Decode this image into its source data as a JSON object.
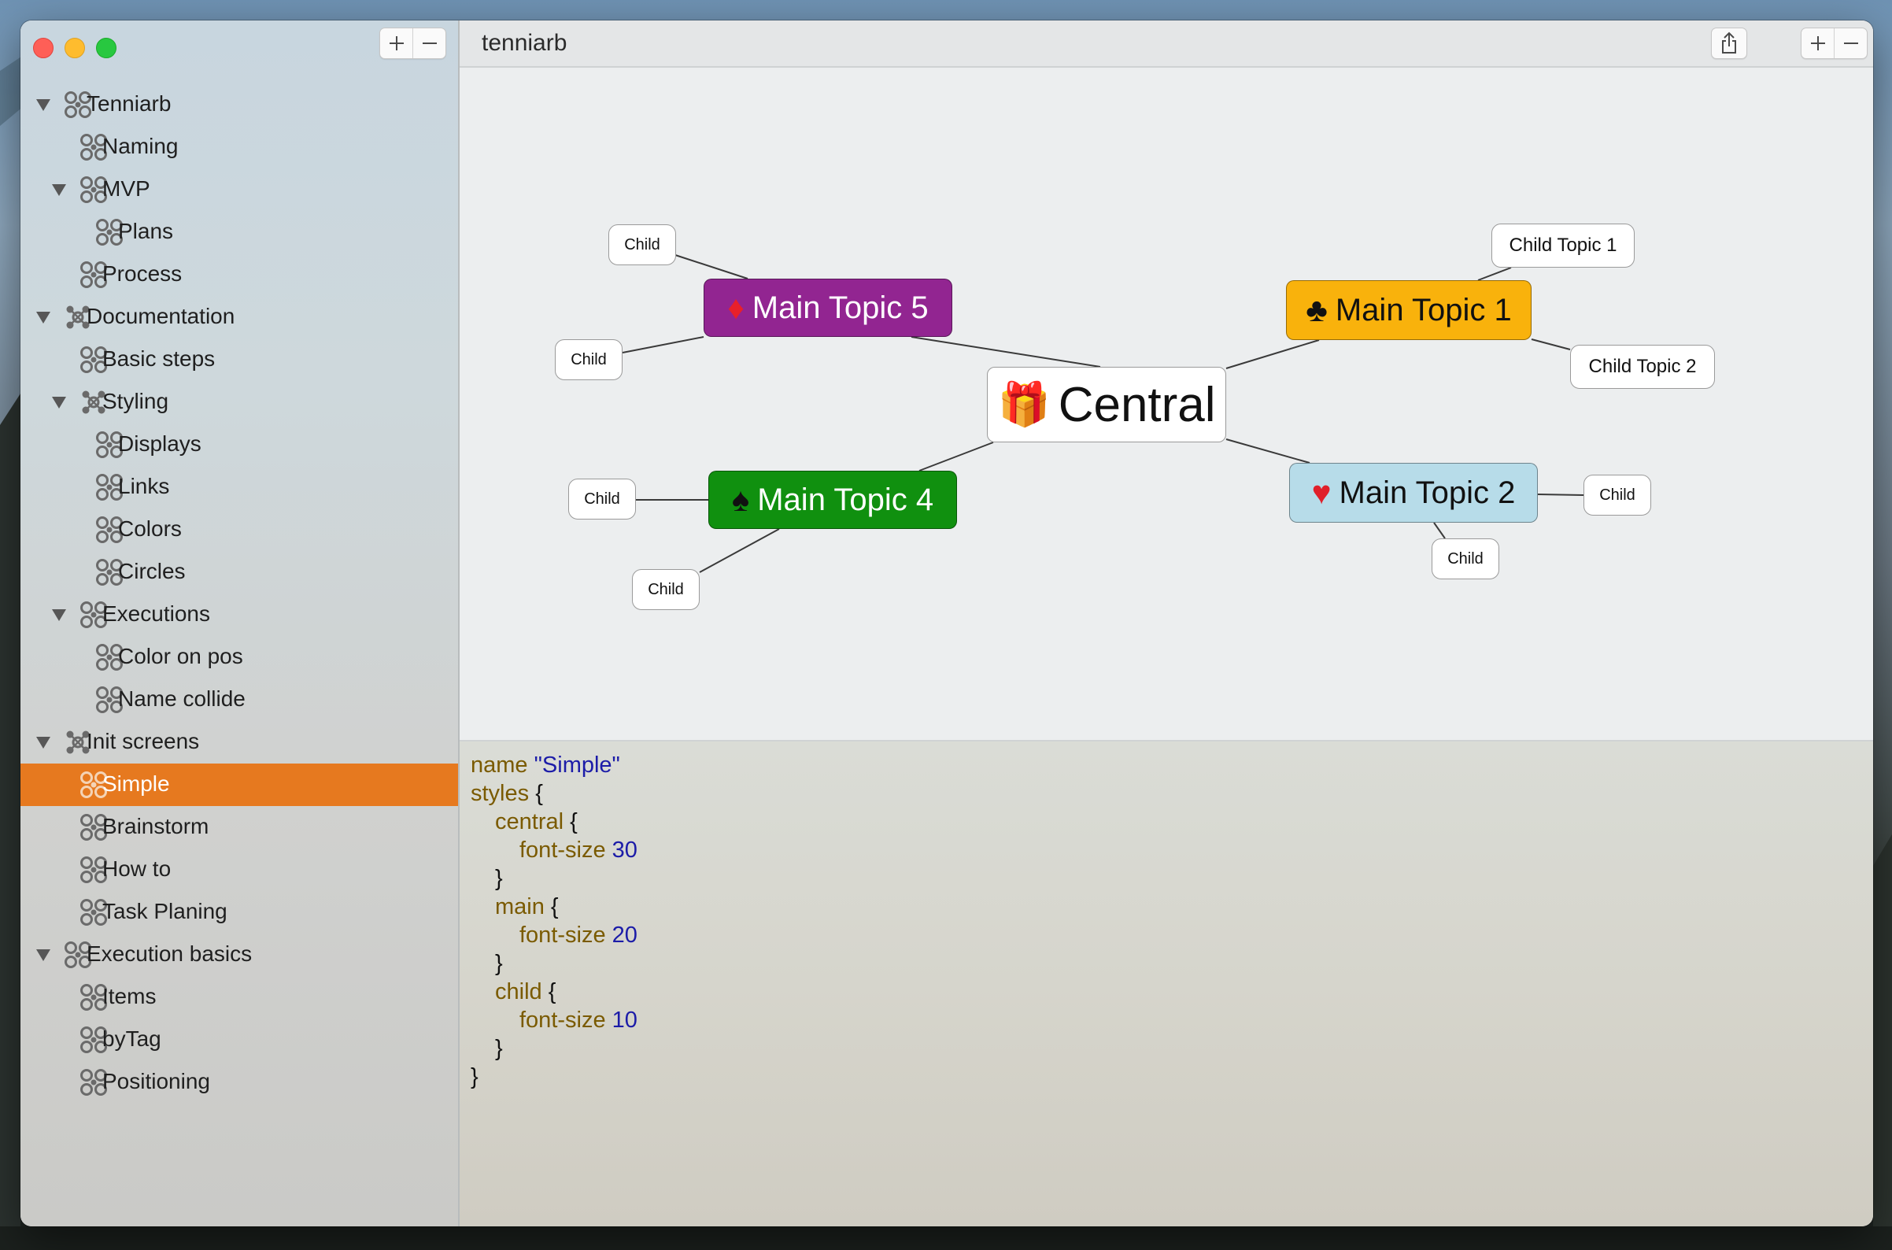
{
  "window": {
    "title": "tenniarb"
  },
  "sidebar": {
    "add_label": "+",
    "remove_label": "−",
    "items": [
      {
        "label": "Tenniarb",
        "level": 0,
        "expanded": true,
        "icon": "mindmap-icon"
      },
      {
        "label": "Naming",
        "level": 1,
        "icon": "mindmap-icon"
      },
      {
        "label": "MVP",
        "level": 1,
        "expanded": true,
        "icon": "mindmap-icon"
      },
      {
        "label": "Plans",
        "level": 2,
        "icon": "mindmap-icon"
      },
      {
        "label": "Process",
        "level": 1,
        "icon": "mindmap-icon"
      },
      {
        "label": "Documentation",
        "level": 0,
        "expanded": true,
        "icon": "network-icon"
      },
      {
        "label": "Basic steps",
        "level": 1,
        "icon": "mindmap-icon"
      },
      {
        "label": "Styling",
        "level": 1,
        "expanded": true,
        "icon": "network-icon"
      },
      {
        "label": "Displays",
        "level": 2,
        "icon": "mindmap-icon"
      },
      {
        "label": "Links",
        "level": 2,
        "icon": "mindmap-icon"
      },
      {
        "label": "Colors",
        "level": 2,
        "icon": "mindmap-icon"
      },
      {
        "label": "Circles",
        "level": 2,
        "icon": "mindmap-icon"
      },
      {
        "label": "Executions",
        "level": 1,
        "expanded": true,
        "icon": "mindmap-icon"
      },
      {
        "label": "Color on pos",
        "level": 2,
        "icon": "mindmap-icon"
      },
      {
        "label": "Name collide",
        "level": 2,
        "icon": "mindmap-icon"
      },
      {
        "label": "Init screens",
        "level": 0,
        "expanded": true,
        "icon": "network-icon"
      },
      {
        "label": "Simple",
        "level": 1,
        "icon": "mindmap-icon",
        "selected": true
      },
      {
        "label": "Brainstorm",
        "level": 1,
        "icon": "mindmap-icon"
      },
      {
        "label": "How to",
        "level": 1,
        "icon": "mindmap-icon"
      },
      {
        "label": "Task Planing",
        "level": 1,
        "icon": "mindmap-icon"
      },
      {
        "label": "Execution basics",
        "level": 0,
        "expanded": true,
        "icon": "mindmap-icon"
      },
      {
        "label": "Items",
        "level": 1,
        "icon": "mindmap-icon"
      },
      {
        "label": "byTag",
        "level": 1,
        "icon": "mindmap-icon"
      },
      {
        "label": "Positioning",
        "level": 1,
        "icon": "mindmap-icon"
      }
    ],
    "selected_color": "#e6791f"
  },
  "toolbar": {
    "share_icon": "share-icon",
    "zoom_in_label": "+",
    "zoom_out_label": "−"
  },
  "mindmap": {
    "central": {
      "label": "Central",
      "emoji": "🎁"
    },
    "main_topics": [
      {
        "id": "mt5",
        "label": "Main Topic 5",
        "emoji": "♦",
        "color": "#922591",
        "text_color": "#ffffff"
      },
      {
        "id": "mt1",
        "label": "Main Topic 1",
        "emoji": "♣",
        "color": "#f9b20c",
        "text_color": "#111111"
      },
      {
        "id": "mt4",
        "label": "Main Topic 4",
        "emoji": "♠",
        "color": "#10900f",
        "text_color": "#ffffff"
      },
      {
        "id": "mt2",
        "label": "Main Topic 2",
        "emoji": "♥",
        "color": "#b7dce9",
        "text_color": "#111111"
      }
    ],
    "children": [
      {
        "id": "c5a",
        "label": "Child",
        "parent": "mt5"
      },
      {
        "id": "c5b",
        "label": "Child",
        "parent": "mt5"
      },
      {
        "id": "c1a",
        "label": "Child Topic 1",
        "parent": "mt1"
      },
      {
        "id": "c1b",
        "label": "Child Topic 2",
        "parent": "mt1"
      },
      {
        "id": "c4a",
        "label": "Child",
        "parent": "mt4"
      },
      {
        "id": "c4b",
        "label": "Child",
        "parent": "mt4"
      },
      {
        "id": "c2a",
        "label": "Child",
        "parent": "mt2"
      },
      {
        "id": "c2b",
        "label": "Child",
        "parent": "mt2"
      }
    ]
  },
  "editor": {
    "lines": [
      {
        "indent": 0,
        "tokens": [
          {
            "t": "name",
            "c": "kw"
          },
          {
            "t": " ",
            "c": ""
          },
          {
            "t": "\"Simple\"",
            "c": "str"
          }
        ]
      },
      {
        "indent": 0,
        "tokens": [
          {
            "t": "styles",
            "c": "kw"
          },
          {
            "t": " {",
            "c": ""
          }
        ]
      },
      {
        "indent": 1,
        "tokens": [
          {
            "t": "central",
            "c": "kw"
          },
          {
            "t": " {",
            "c": ""
          }
        ]
      },
      {
        "indent": 2,
        "tokens": [
          {
            "t": "font-size",
            "c": "kw"
          },
          {
            "t": " ",
            "c": ""
          },
          {
            "t": "30",
            "c": "num"
          }
        ]
      },
      {
        "indent": 1,
        "tokens": [
          {
            "t": "}",
            "c": ""
          }
        ]
      },
      {
        "indent": 1,
        "tokens": [
          {
            "t": "main",
            "c": "kw"
          },
          {
            "t": " {",
            "c": ""
          }
        ]
      },
      {
        "indent": 2,
        "tokens": [
          {
            "t": "font-size",
            "c": "kw"
          },
          {
            "t": " ",
            "c": ""
          },
          {
            "t": "20",
            "c": "num"
          }
        ]
      },
      {
        "indent": 1,
        "tokens": [
          {
            "t": "}",
            "c": ""
          }
        ]
      },
      {
        "indent": 1,
        "tokens": [
          {
            "t": "child",
            "c": "kw"
          },
          {
            "t": " {",
            "c": ""
          }
        ]
      },
      {
        "indent": 2,
        "tokens": [
          {
            "t": "font-size",
            "c": "kw"
          },
          {
            "t": " ",
            "c": ""
          },
          {
            "t": "10",
            "c": "num"
          }
        ]
      },
      {
        "indent": 1,
        "tokens": [
          {
            "t": "}",
            "c": ""
          }
        ]
      },
      {
        "indent": 0,
        "tokens": [
          {
            "t": "}",
            "c": ""
          }
        ]
      }
    ]
  }
}
